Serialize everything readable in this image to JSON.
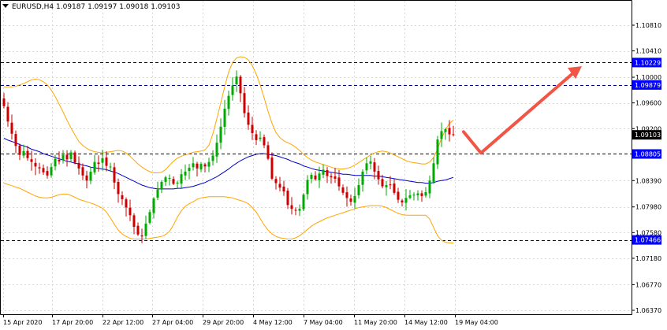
{
  "header": {
    "symbol": "EURUSD,H4",
    "open": "1.09187",
    "high": "1.09197",
    "low": "1.09018",
    "close": "1.09103"
  },
  "colors": {
    "background": "#ffffff",
    "grid": "#d8d8d8",
    "bull": "#00aa00",
    "bear": "#cc0000",
    "level": "#000080",
    "bands": "#ffa500",
    "ma": "#0000cc",
    "arrow": "#f05545",
    "tag_bg": "#0000ff",
    "tag_text": "#ffffff",
    "price_tag_bg": "#000000"
  },
  "chart_data": {
    "type": "candlestick",
    "ylim": [
      1.0637,
      1.1081
    ],
    "x_tick_labels": [
      "15 Apr 2020",
      "17 Apr 20:00",
      "22 Apr 12:00",
      "27 Apr 04:00",
      "29 Apr 20:00",
      "4 May 12:00",
      "7 May 04:00",
      "11 May 20:00",
      "14 May 12:00",
      "19 May 04:00"
    ],
    "y_tick_labels": [
      "1.10810",
      "1.10410",
      "1.10000",
      "1.09600",
      "1.09200",
      "1.08390",
      "1.07980",
      "1.07580",
      "1.07180",
      "1.06770",
      "1.06370"
    ],
    "horizontal_levels": [
      {
        "label": "1.10229",
        "value": 1.10229
      },
      {
        "label": "1.09879",
        "value": 1.09879
      },
      {
        "label": "1.08805",
        "value": 1.08805
      },
      {
        "label": "1.07466",
        "value": 1.07466
      }
    ],
    "current_price": {
      "label": "1.09103",
      "value": 1.09103
    },
    "forecast_arrow": [
      [
        1.0915,
        1.0882
      ],
      [
        1.0882,
        1.1017
      ]
    ],
    "candle_count": 115,
    "closes": [
      1.0955,
      1.0931,
      1.0912,
      1.0893,
      1.0879,
      1.0885,
      1.0874,
      1.0868,
      1.0861,
      1.0858,
      1.0852,
      1.0847,
      1.086,
      1.0873,
      1.0869,
      1.0879,
      1.0872,
      1.0883,
      1.0867,
      1.0858,
      1.0847,
      1.0839,
      1.0853,
      1.0868,
      1.0865,
      1.0874,
      1.0862,
      1.0861,
      1.0836,
      1.0818,
      1.081,
      1.0797,
      1.0785,
      1.0767,
      1.0755,
      1.0752,
      1.0772,
      1.079,
      1.0811,
      1.0825,
      1.0837,
      1.0844,
      1.0843,
      1.0834,
      1.0836,
      1.0849,
      1.0853,
      1.0859,
      1.0866,
      1.0858,
      1.0865,
      1.0861,
      1.0868,
      1.0878,
      1.0898,
      1.0923,
      1.0951,
      1.0971,
      1.0987,
      1.1001,
      1.0975,
      1.0944,
      1.0926,
      1.0913,
      1.0902,
      1.0906,
      1.0894,
      1.0873,
      1.0842,
      1.0835,
      1.0828,
      1.0822,
      1.0801,
      1.0795,
      1.0793,
      1.0795,
      1.0817,
      1.084,
      1.0848,
      1.0841,
      1.085,
      1.0856,
      1.0846,
      1.0844,
      1.0842,
      1.083,
      1.082,
      1.0812,
      1.0806,
      1.0815,
      1.0832,
      1.0853,
      1.0866,
      1.0869,
      1.0853,
      1.0841,
      1.083,
      1.0832,
      1.0833,
      1.082,
      1.0809,
      1.0805,
      1.0812,
      1.0816,
      1.0817,
      1.0819,
      1.0815,
      1.0821,
      1.0839,
      1.0866,
      1.0903,
      1.0916,
      1.0919,
      1.0911,
      1.091
    ],
    "moving_average_values": [
      1.0905,
      1.0902,
      1.09,
      1.0898,
      1.0895,
      1.0893,
      1.0891,
      1.0888,
      1.0886,
      1.0884,
      1.0881,
      1.0879,
      1.0877,
      1.0875,
      1.0873,
      1.0871,
      1.0869,
      1.0868,
      1.0866,
      1.0865,
      1.0863,
      1.0862,
      1.086,
      1.0859,
      1.0858,
      1.0857,
      1.0856,
      1.0854,
      1.0852,
      1.085,
      1.0847,
      1.0844,
      1.0841,
      1.0838,
      1.0835,
      1.0832,
      1.083,
      1.0828,
      1.0827,
      1.0826,
      1.0826,
      1.0826,
      1.0826,
      1.0826,
      1.0827,
      1.0827,
      1.0828,
      1.0829,
      1.083,
      1.0832,
      1.0834,
      1.0836,
      1.0839,
      1.0842,
      1.0845,
      1.0849,
      1.0853,
      1.0857,
      1.0862,
      1.0866,
      1.087,
      1.0873,
      1.0876,
      1.0878,
      1.088,
      1.0881,
      1.0881,
      1.088,
      1.0879,
      1.0878,
      1.0876,
      1.0874,
      1.0872,
      1.0869,
      1.0867,
      1.0865,
      1.0862,
      1.086,
      1.0858,
      1.0856,
      1.0855,
      1.0854,
      1.0853,
      1.0852,
      1.0851,
      1.085,
      1.0849,
      1.0849,
      1.0848,
      1.0847,
      1.0847,
      1.0847,
      1.0847,
      1.0847,
      1.0846,
      1.0846,
      1.0845,
      1.0844,
      1.0843,
      1.0842,
      1.0841,
      1.084,
      1.0839,
      1.0838,
      1.0837,
      1.0836,
      1.0836,
      1.0835,
      1.0835,
      1.0836,
      1.0838,
      1.0839,
      1.084,
      1.0842,
      1.0844
    ],
    "bands_upper": [
      1.0985,
      1.0985,
      1.0985,
      1.0986,
      1.0988,
      1.099,
      1.0993,
      1.0996,
      1.0997,
      1.0996,
      1.0993,
      1.0988,
      1.098,
      1.097,
      1.0958,
      1.0946,
      1.0933,
      1.0921,
      1.091,
      1.09,
      1.0894,
      1.0889,
      1.0886,
      1.0884,
      1.0883,
      1.0882,
      1.0883,
      1.0884,
      1.0885,
      1.0886,
      1.0885,
      1.0882,
      1.0877,
      1.0871,
      1.0865,
      1.086,
      1.0856,
      1.0853,
      1.0851,
      1.0851,
      1.0852,
      1.0856,
      1.0863,
      1.0869,
      1.0874,
      1.0877,
      1.0879,
      1.0881,
      1.0883,
      1.0884,
      1.0885,
      1.0887,
      1.0894,
      1.0912,
      1.0935,
      1.096,
      1.0985,
      1.1008,
      1.1023,
      1.103,
      1.1032,
      1.1031,
      1.1027,
      1.1018,
      1.1005,
      1.0988,
      1.0968,
      1.0947,
      1.0928,
      1.0914,
      1.0906,
      1.0901,
      1.0898,
      1.0895,
      1.0891,
      1.0886,
      1.088,
      1.0875,
      1.0871,
      1.0868,
      1.0866,
      1.0864,
      1.0862,
      1.086,
      1.0858,
      1.0857,
      1.0857,
      1.0858,
      1.086,
      1.0863,
      1.0867,
      1.0871,
      1.0875,
      1.0879,
      1.0882,
      1.0884,
      1.0885,
      1.0884,
      1.0882,
      1.0879,
      1.0876,
      1.0873,
      1.087,
      1.0868,
      1.0867,
      1.0866,
      1.0865,
      1.0865,
      1.0868,
      1.0875,
      1.0888,
      1.0905,
      1.0918,
      1.0928,
      1.0933
    ],
    "bands_lower": [
      1.0835,
      1.0833,
      1.0831,
      1.0829,
      1.0827,
      1.0824,
      1.0821,
      1.0818,
      1.0815,
      1.0813,
      1.0812,
      1.0812,
      1.0813,
      1.0815,
      1.0817,
      1.0818,
      1.0818,
      1.0816,
      1.0813,
      1.081,
      1.0808,
      1.0806,
      1.0804,
      1.0802,
      1.0799,
      1.0796,
      1.079,
      1.0781,
      1.0771,
      1.0762,
      1.0756,
      1.0752,
      1.0749,
      1.0748,
      1.0748,
      1.0748,
      1.0748,
      1.0749,
      1.075,
      1.0751,
      1.0752,
      1.0755,
      1.076,
      1.077,
      1.0782,
      1.0792,
      1.0799,
      1.0803,
      1.0806,
      1.081,
      1.0812,
      1.0813,
      1.0814,
      1.0814,
      1.0814,
      1.0814,
      1.0814,
      1.0813,
      1.0812,
      1.081,
      1.0808,
      1.0806,
      1.0803,
      1.0797,
      1.079,
      1.078,
      1.077,
      1.0762,
      1.0756,
      1.0752,
      1.075,
      1.0749,
      1.0748,
      1.0748,
      1.075,
      1.0753,
      1.0758,
      1.0763,
      1.0768,
      1.0772,
      1.0775,
      1.0778,
      1.0781,
      1.0783,
      1.0785,
      1.0787,
      1.0789,
      1.0791,
      1.0793,
      1.0795,
      1.0797,
      1.0798,
      1.0799,
      1.08,
      1.08,
      1.08,
      1.0799,
      1.0797,
      1.0794,
      1.0791,
      1.0788,
      1.0786,
      1.0785,
      1.0785,
      1.0785,
      1.0785,
      1.0785,
      1.0785,
      1.0779,
      1.0766,
      1.0753,
      1.0746,
      1.0743,
      1.0742,
      1.0742
    ]
  }
}
